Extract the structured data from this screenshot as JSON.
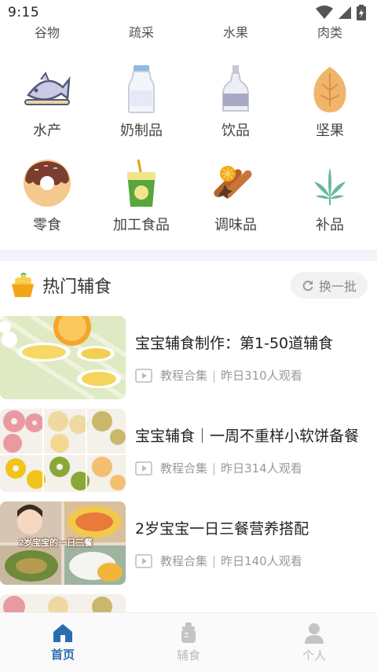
{
  "status": {
    "time": "9:15"
  },
  "categories_top": [
    "谷物",
    "疏采",
    "水果",
    "肉类"
  ],
  "categories_row1": [
    {
      "label": "水产",
      "icon": "fish-icon"
    },
    {
      "label": "奶制品",
      "icon": "milk-bottle-icon"
    },
    {
      "label": "饮品",
      "icon": "drink-bottle-icon"
    },
    {
      "label": "坚果",
      "icon": "nut-icon"
    }
  ],
  "categories_row2": [
    {
      "label": "零食",
      "icon": "donut-icon"
    },
    {
      "label": "加工食品",
      "icon": "cup-drink-icon"
    },
    {
      "label": "调味品",
      "icon": "spice-icon"
    },
    {
      "label": "补品",
      "icon": "herb-leaf-icon"
    }
  ],
  "hot": {
    "title": "热门辅食",
    "refresh_label": "换一批"
  },
  "feed": [
    {
      "title": "宝宝辅食制作：第1-50道辅食",
      "type": "教程合集",
      "views": "昨日310人观看"
    },
    {
      "title": "宝宝辅食｜一周不重样小软饼备餐",
      "type": "教程合集",
      "views": "昨日314人观看"
    },
    {
      "title": "2岁宝宝一日三餐营养搭配",
      "type": "教程合集",
      "views": "昨日140人观看",
      "thumb_caption": "2岁宝宝的一日三餐"
    }
  ],
  "nav": {
    "home": "首页",
    "food": "辅食",
    "profile": "个人"
  },
  "colors": {
    "accent": "#2b6cb0"
  }
}
